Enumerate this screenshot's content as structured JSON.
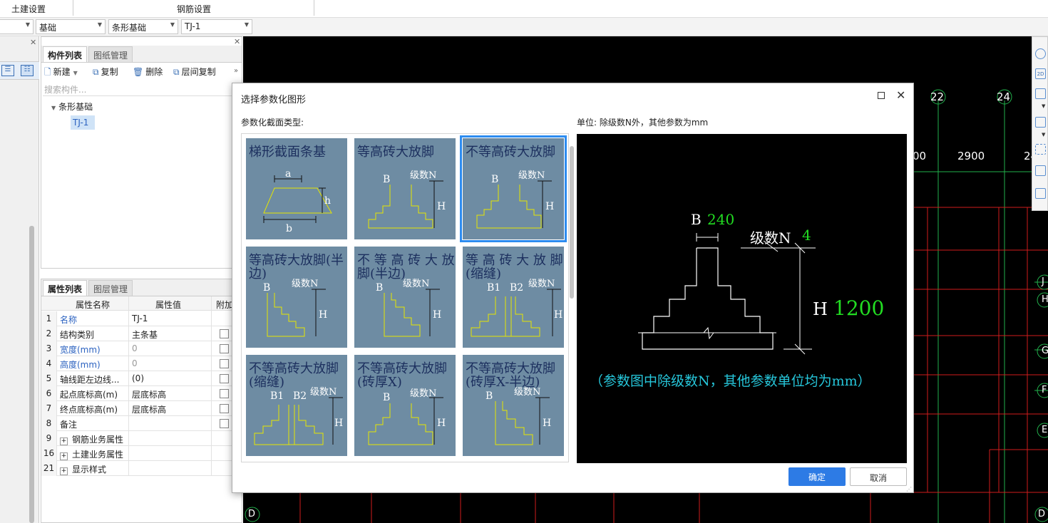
{
  "ribbon": {
    "civil_settings": "土建设置",
    "rebar_settings": "钢筋设置"
  },
  "dropdowns": {
    "d2": "基础",
    "d3": "条形基础",
    "d4": "TJ-1"
  },
  "component_panel": {
    "tab_active": "构件列表",
    "tab_inactive": "图纸管理",
    "new_label": "新建",
    "copy_label": "复制",
    "delete_label": "删除",
    "floor_copy_label": "层间复制",
    "search_placeholder": "搜索构件...",
    "tree_parent": "条形基础",
    "tree_child": "TJ-1"
  },
  "property_panel": {
    "tab_active": "属性列表",
    "tab_inactive": "图层管理",
    "headers": {
      "name": "属性名称",
      "value": "属性值",
      "extra": "附加"
    },
    "rows": [
      {
        "num": "1",
        "name": "名称",
        "value": "TJ-1",
        "blue": true,
        "check": false
      },
      {
        "num": "2",
        "name": "结构类别",
        "value": "主条基",
        "blue": false,
        "check": true
      },
      {
        "num": "3",
        "name": "宽度(mm)",
        "value": "0",
        "blue": true,
        "check": true
      },
      {
        "num": "4",
        "name": "高度(mm)",
        "value": "0",
        "blue": true,
        "check": true
      },
      {
        "num": "5",
        "name": "轴线距左边线...",
        "value": "(0)",
        "blue": false,
        "check": true
      },
      {
        "num": "6",
        "name": "起点底标高(m)",
        "value": "层底标高",
        "blue": false,
        "check": true
      },
      {
        "num": "7",
        "name": "终点底标高(m)",
        "value": "层底标高",
        "blue": false,
        "check": true
      },
      {
        "num": "8",
        "name": "备注",
        "value": "",
        "blue": false,
        "check": true
      },
      {
        "num": "9",
        "name": "钢筋业务属性",
        "value": "",
        "group": true
      },
      {
        "num": "16",
        "name": "土建业务属性",
        "value": "",
        "group": true
      },
      {
        "num": "21",
        "name": "显示样式",
        "value": "",
        "group": true
      }
    ]
  },
  "cad": {
    "axis_22": "22",
    "axis_24": "24",
    "dim_left": "00",
    "dim_2900": "2900",
    "dim_right": "24",
    "axis_D_left": "D",
    "axis_D_right": "D",
    "side_J": "J",
    "side_H": "H",
    "side_G": "G",
    "side_F": "F",
    "side_E": "E"
  },
  "dialog": {
    "title": "选择参数化图形",
    "section_label": "参数化截面类型:",
    "unit_label": "单位:   除级数N外，其他参数为mm",
    "ok": "确定",
    "cancel": "取消",
    "cells": [
      {
        "title": "梯形截面条基"
      },
      {
        "title": "等高砖大放脚"
      },
      {
        "title": "不等高砖大放脚"
      },
      {
        "title": "等高砖大放脚(半边)"
      },
      {
        "title": "不 等 高 砖 大 放脚(半边)"
      },
      {
        "title": "等 高 砖 大 放 脚(缩缝)"
      },
      {
        "title": "不等高砖大放脚(缩缝)"
      },
      {
        "title": "不等高砖大放脚(砖厚X)"
      },
      {
        "title": "不等高砖大放脚(砖厚X-半边)"
      }
    ],
    "preview": {
      "b_label": "B",
      "b_value": "240",
      "n_label": "级数N",
      "n_value": "4",
      "h_label": "H",
      "h_value": "1200",
      "note": "（参数图中除级数N，其他参数单位均为mm）"
    }
  },
  "colors": {
    "accent": "#2d7be5",
    "cell_bg": "#6e8ca3",
    "cad_bg": "#000000",
    "cad_red": "#d11d1d",
    "cad_green": "#22b14c"
  }
}
